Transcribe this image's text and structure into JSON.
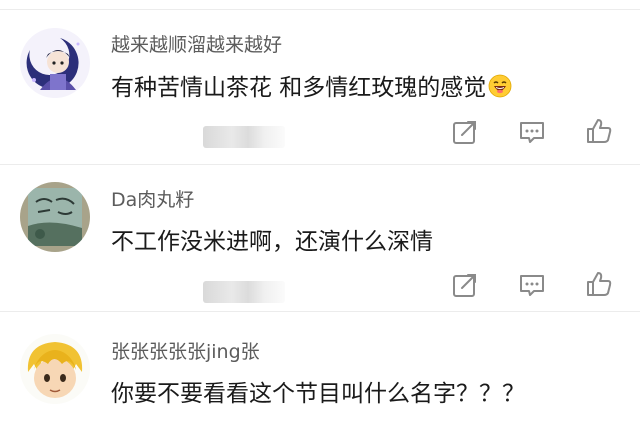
{
  "comments": [
    {
      "username": "越来越顺溜越来越好",
      "text": "有种苦情山茶花 和多情红玫瑰的感觉",
      "emoji": "laughing-emoji",
      "avatar": "anime-boy-moon-avatar",
      "actions": [
        "forward-icon",
        "comment-icon",
        "like-icon"
      ]
    },
    {
      "username": "Da肉丸籽",
      "text": "不工作没米进啊，还演什么深情",
      "avatar": "book-photo-avatar",
      "actions": [
        "forward-icon",
        "comment-icon",
        "like-icon"
      ]
    },
    {
      "username": "张张张张张jing张",
      "text": "你要不要看看这个节目叫什么名字？？？",
      "avatar": "cartoon-blond-boy-avatar"
    }
  ],
  "colors": {
    "username": "#5c5c5c",
    "text": "#1a1a1a",
    "icon": "#8a8a8a",
    "divider": "#ececec"
  }
}
